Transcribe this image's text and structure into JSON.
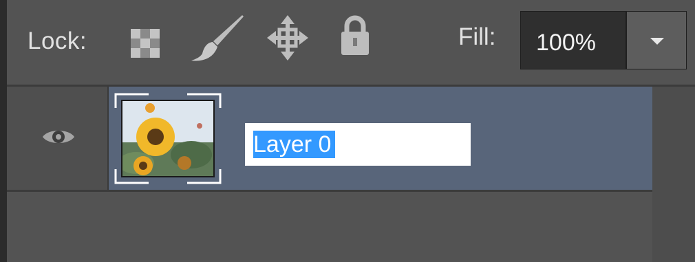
{
  "panel": {
    "lock_label": "Lock:",
    "fill_label": "Fill:",
    "fill_value": "100%",
    "lock_icons": [
      "transparency-checker-icon",
      "brush-icon",
      "move-arrows-icon",
      "padlock-icon"
    ]
  },
  "layer": {
    "name": "Layer 0",
    "visible": true,
    "selected": true
  },
  "colors": {
    "panel_bg": "#535353",
    "selection": "#58657a",
    "text_highlight": "#3399ff"
  }
}
